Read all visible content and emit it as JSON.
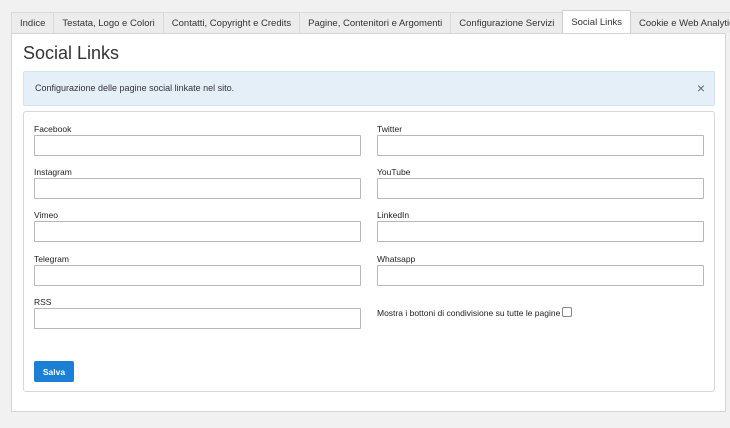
{
  "tabs": [
    {
      "label": "Indice"
    },
    {
      "label": "Testata, Logo e Colori"
    },
    {
      "label": "Contatti, Copyright e Credits"
    },
    {
      "label": "Pagine, Contenitori e Argomenti"
    },
    {
      "label": "Configurazione Servizi"
    },
    {
      "label": "Social Links",
      "active": true
    },
    {
      "label": "Cookie e Web Analytics"
    }
  ],
  "page": {
    "title": "Social Links",
    "alert_text": "Configurazione delle pagine social linkate nel sito.",
    "close_icon": "×"
  },
  "form": {
    "fields": [
      {
        "label": "Facebook",
        "value": ""
      },
      {
        "label": "Twitter",
        "value": ""
      },
      {
        "label": "Instagram",
        "value": ""
      },
      {
        "label": "YouTube",
        "value": ""
      },
      {
        "label": "Vimeo",
        "value": ""
      },
      {
        "label": "LinkedIn",
        "value": ""
      },
      {
        "label": "Telegram",
        "value": ""
      },
      {
        "label": "Whatsapp",
        "value": ""
      },
      {
        "label": "RSS",
        "value": ""
      }
    ],
    "share_label": "Mostra i bottoni di condivisione su tutte le pagine",
    "share_checked": false,
    "save_label": "Salva"
  },
  "colors": {
    "accent": "#1b7fd6",
    "alert_bg": "#e5eff8"
  }
}
